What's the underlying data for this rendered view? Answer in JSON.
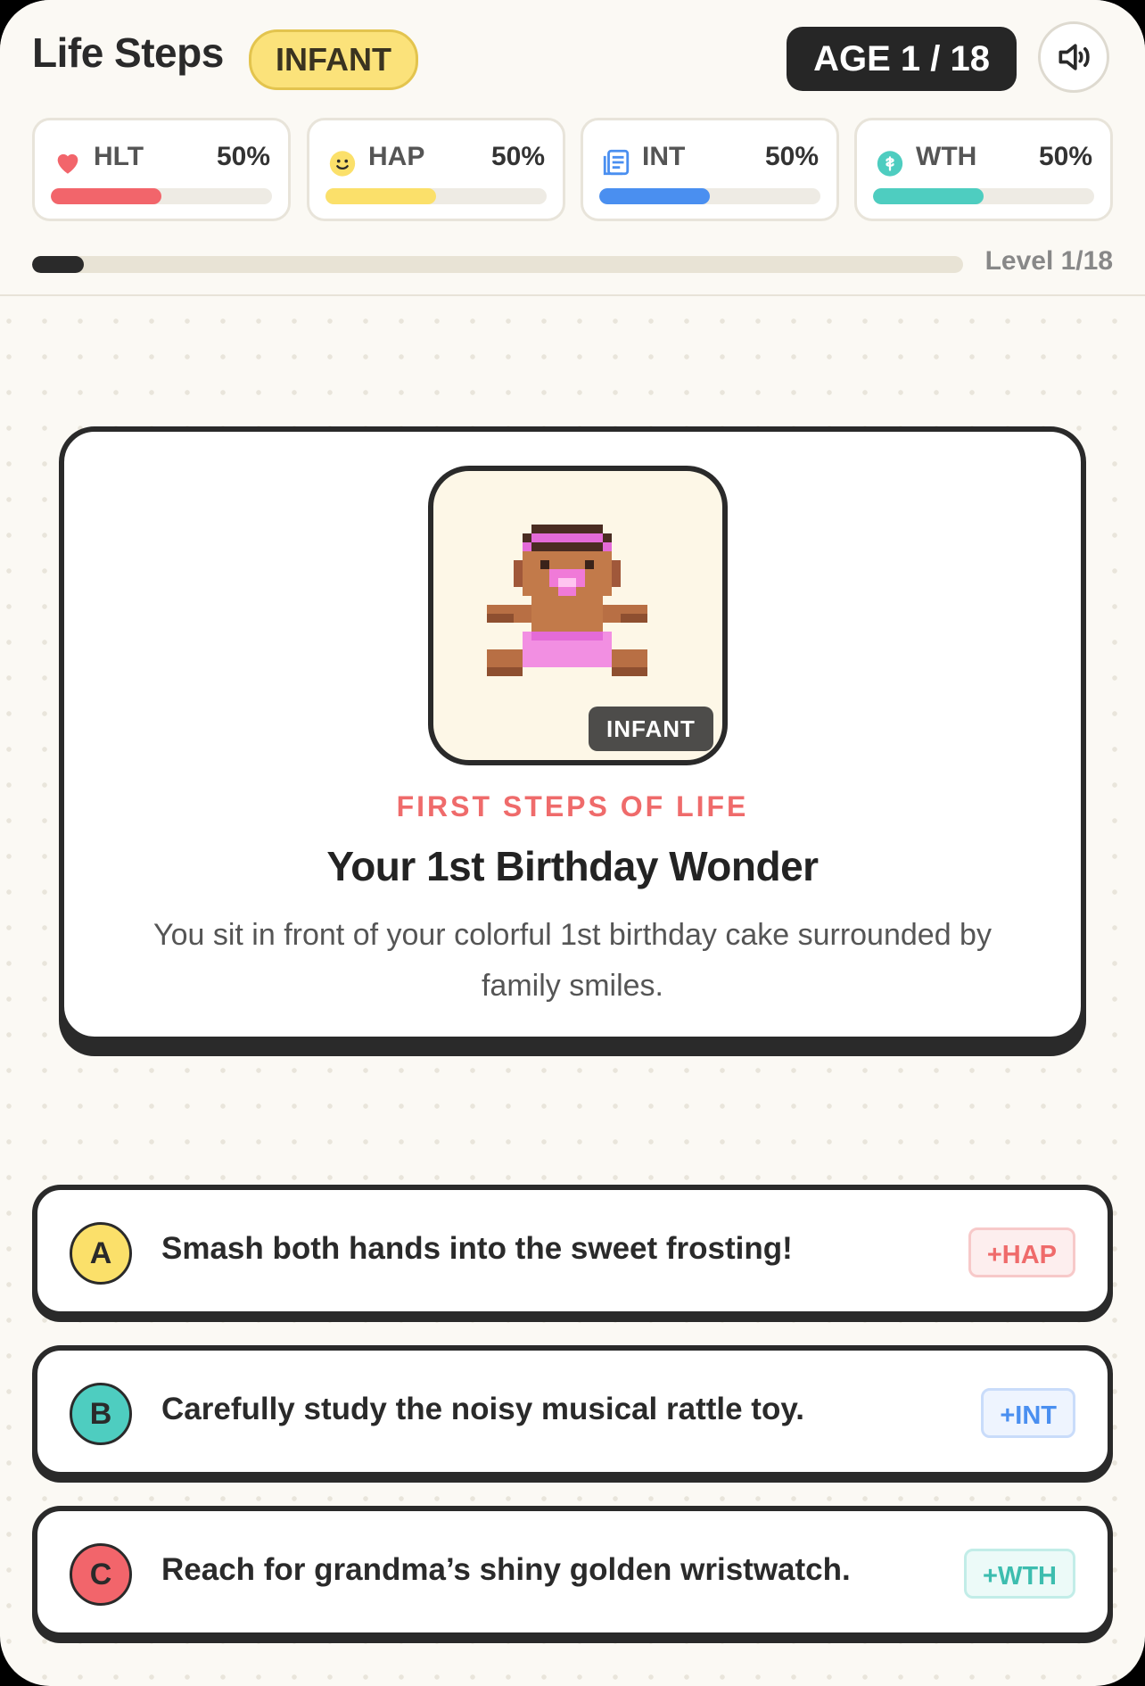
{
  "header": {
    "title": "Life Steps",
    "stage_badge": "INFANT",
    "age_label": "AGE 1 / 18",
    "sound_icon": "speaker-icon"
  },
  "stats": [
    {
      "label": "HLT",
      "value": "50%",
      "fill": 0.5,
      "color": "#f2656b",
      "icon": "heart-icon"
    },
    {
      "label": "HAP",
      "value": "50%",
      "fill": 0.5,
      "color": "#fbe06a",
      "icon": "smiley-icon"
    },
    {
      "label": "INT",
      "value": "50%",
      "fill": 0.5,
      "color": "#4a8ff0",
      "icon": "book-icon"
    },
    {
      "label": "WTH",
      "value": "50%",
      "fill": 0.5,
      "color": "#4ecdc0",
      "icon": "coin-icon"
    }
  ],
  "level": {
    "text": "Level 1/18",
    "progress": 0.0556
  },
  "scene": {
    "portrait_tag": "INFANT",
    "kicker": "FIRST STEPS OF LIFE",
    "title": "Your 1st Birthday Wonder",
    "description": "You sit in front of your colorful 1st birthday cake surrounded by family smiles."
  },
  "choices": [
    {
      "letter": "A",
      "text": "Smash both hands into the sweet frosting!",
      "tag": "+HAP",
      "letter_bg": "#fbe06a",
      "tag_color": "#ef6b6b",
      "tag_bg": "#fdeeee",
      "tag_border": "#f7c9c9"
    },
    {
      "letter": "B",
      "text": "Carefully study the noisy musical rattle toy.",
      "tag": "+INT",
      "letter_bg": "#4ecdc0",
      "tag_color": "#4a8ff0",
      "tag_bg": "#eef4fe",
      "tag_border": "#c9dcfa"
    },
    {
      "letter": "C",
      "text": "Reach for grandma’s shiny golden wristwatch.",
      "tag": "+WTH",
      "letter_bg": "#f2656b",
      "tag_color": "#3dbdaf",
      "tag_bg": "#ecfaf8",
      "tag_border": "#c2ede8"
    }
  ]
}
